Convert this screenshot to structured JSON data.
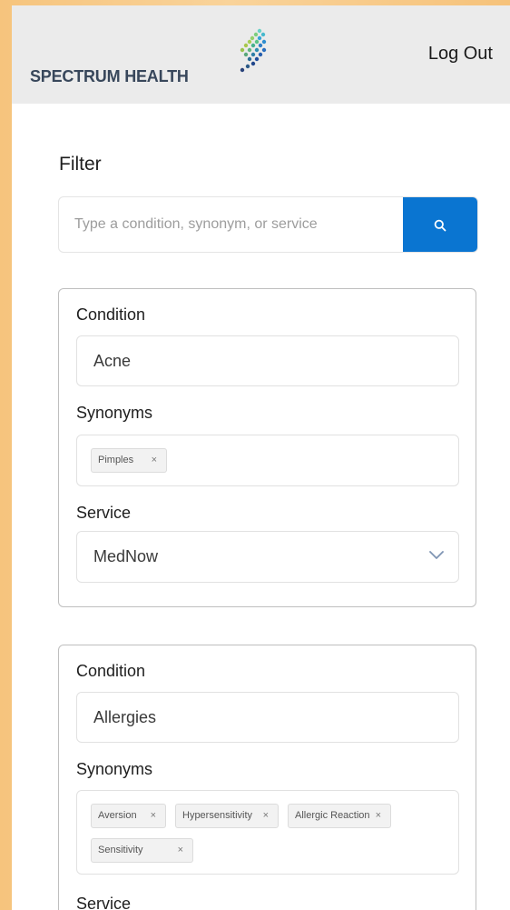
{
  "header": {
    "brand": "SPECTRUM HEALTH",
    "logout_label": "Log Out"
  },
  "filter": {
    "title": "Filter",
    "search_placeholder": "Type a condition, synonym, or service"
  },
  "cards": [
    {
      "condition_label": "Condition",
      "condition_value": "Acne",
      "synonyms_label": "Synonyms",
      "synonyms": [
        "Pimples"
      ],
      "service_label": "Service",
      "service_value": "MedNow"
    },
    {
      "condition_label": "Condition",
      "condition_value": "Allergies",
      "synonyms_label": "Synonyms",
      "synonyms": [
        "Aversion",
        "Hypersensitivity",
        "Allergic Reaction",
        "Sensitivity"
      ],
      "service_label": "Service"
    }
  ],
  "colors": {
    "primary_blue": "#0A75D1",
    "header_bg": "#EBEBEB",
    "brand_text": "#38475B"
  },
  "icons": {
    "remove_tag": "×",
    "search": "search-icon",
    "dropdown": "chevron-down-icon"
  }
}
